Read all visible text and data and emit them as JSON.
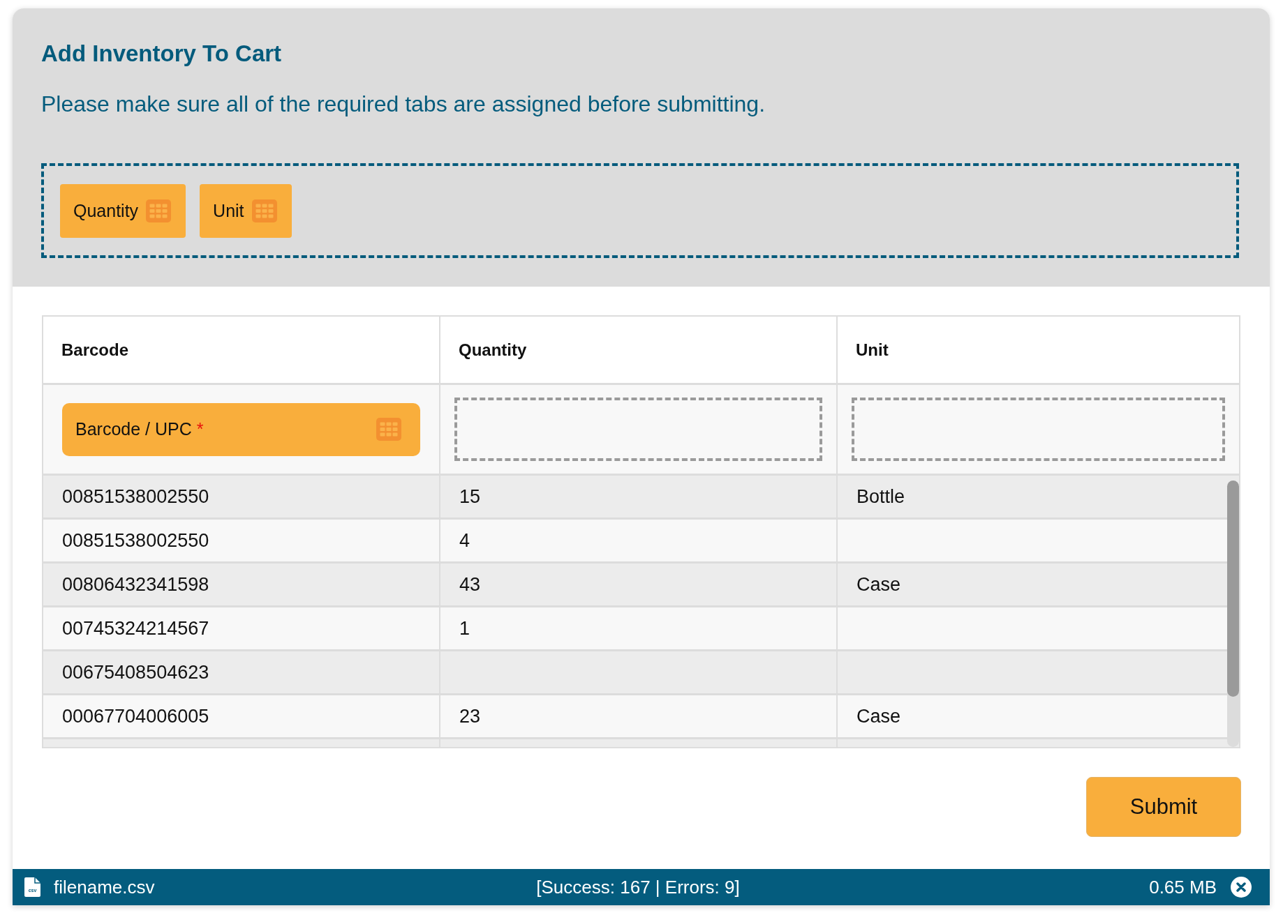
{
  "dialog": {
    "title": "Add Inventory To Cart",
    "instructions": "Please make sure all of the required tabs are assigned before submitting."
  },
  "available_tabs": [
    {
      "label": "Quantity"
    },
    {
      "label": "Unit"
    }
  ],
  "table": {
    "columns": [
      {
        "heading": "Barcode",
        "assigned_tab": {
          "label": "Barcode / UPC",
          "required_mark": "*"
        }
      },
      {
        "heading": "Quantity"
      },
      {
        "heading": "Unit"
      }
    ],
    "rows": [
      [
        "00851538002550",
        "15",
        "Bottle"
      ],
      [
        "00851538002550",
        "4",
        null
      ],
      [
        "00806432341598",
        "43",
        "Case"
      ],
      [
        "00745324214567",
        "1",
        null
      ],
      [
        "00675408504623",
        null,
        null
      ],
      [
        "00067704006005",
        "23",
        "Case"
      ]
    ]
  },
  "submit_button": {
    "label": "Submit"
  },
  "file_bar": {
    "icon_label": "csv",
    "filename": "filename.csv",
    "summary": "[Success: 167 | Errors: 9]",
    "size": "0.65 MB"
  }
}
